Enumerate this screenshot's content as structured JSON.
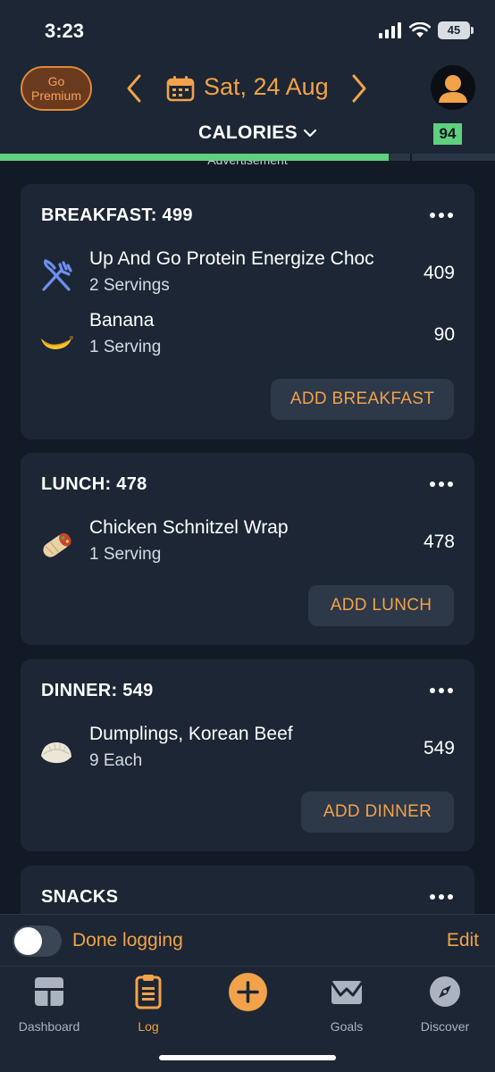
{
  "status_bar": {
    "time": "3:23",
    "battery": "45"
  },
  "header": {
    "premium_line1": "Go",
    "premium_line2": "Premium",
    "date": "Sat, 24 Aug",
    "tab_label": "CALORIES",
    "score": "94",
    "calorie_progress": 0.785,
    "ad_label": "Advertisement"
  },
  "meals": [
    {
      "title": "BREAKFAST: 499",
      "add_label": "ADD BREAKFAST",
      "items": [
        {
          "name": "Up And Go Protein Energize Choc",
          "serving": "2 Servings",
          "calories": "409",
          "icon": "fork-knife-icon"
        },
        {
          "name": "Banana",
          "serving": "1 Serving",
          "calories": "90",
          "icon": "banana-icon"
        }
      ]
    },
    {
      "title": "LUNCH: 478",
      "add_label": "ADD LUNCH",
      "items": [
        {
          "name": "Chicken Schnitzel Wrap",
          "serving": "1 Serving",
          "calories": "478",
          "icon": "burrito-icon"
        }
      ]
    },
    {
      "title": "DINNER: 549",
      "add_label": "ADD DINNER",
      "items": [
        {
          "name": "Dumplings, Korean Beef",
          "serving": "9 Each",
          "calories": "549",
          "icon": "dumpling-icon"
        }
      ]
    },
    {
      "title": "SNACKS"
    }
  ],
  "footer": {
    "done_label": "Done logging",
    "edit_label": "Edit"
  },
  "tabs": [
    {
      "label": "Dashboard",
      "icon": "dashboard-icon"
    },
    {
      "label": "Log",
      "icon": "clipboard-icon"
    },
    {
      "label": "",
      "icon": "plus-icon"
    },
    {
      "label": "Goals",
      "icon": "envelope-chart-icon"
    },
    {
      "label": "Discover",
      "icon": "compass-icon"
    }
  ],
  "colors": {
    "accent": "#f2a24a",
    "progress": "#5fd07d",
    "card": "#1c2634",
    "background": "#121a26"
  }
}
